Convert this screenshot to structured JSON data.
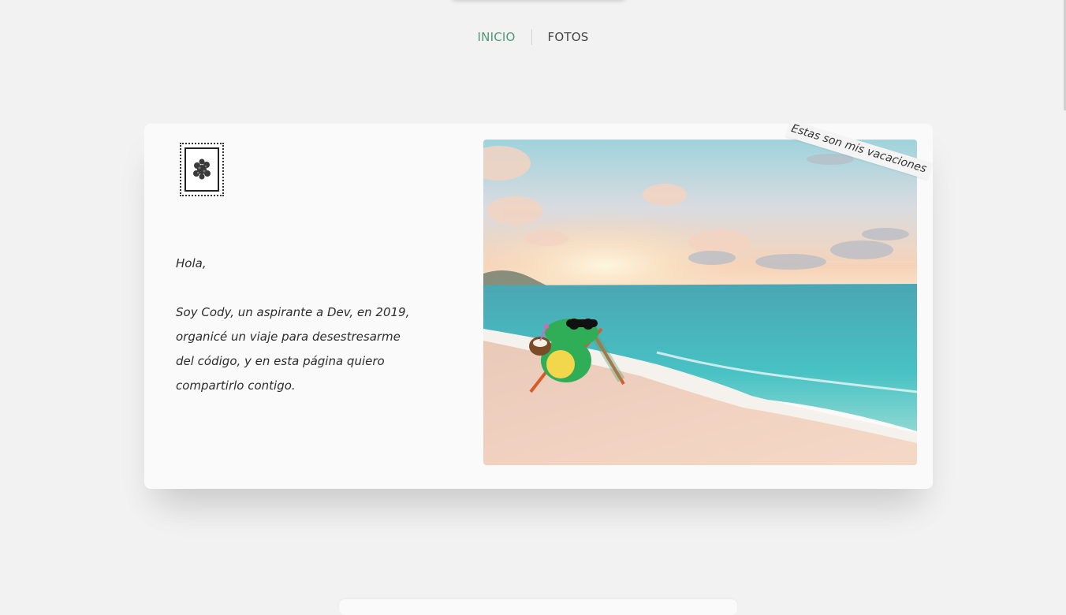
{
  "nav": {
    "items": [
      {
        "label": "INICIO",
        "active": true
      },
      {
        "label": "FOTOS",
        "active": false
      }
    ],
    "active_color": "#4d9a78"
  },
  "card": {
    "stamp_icon": "flower-stamp-icon",
    "letter": {
      "greeting": "Hola,",
      "lines": [
        "Soy Cody, un aspirante a Dev, en 2019,",
        "organicé un viaje para desestresarme",
        "del código, y en esta página quiero",
        "compartirlo contigo."
      ]
    },
    "photo": {
      "icon": "beach-crocodile-image"
    },
    "tag_note": "Estas son mis vacaciones"
  }
}
